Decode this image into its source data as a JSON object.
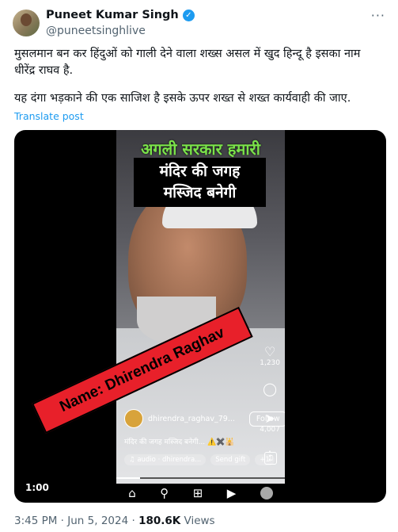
{
  "author": {
    "name": "Puneet Kumar Singh",
    "handle": "@puneetsinghlive",
    "more_icon": "more-icon"
  },
  "tweet": {
    "paragraph1": "मुसलमान बन कर हिंदुओं को गाली देने वाला शख्स असल में खुद हिन्दू है इसका नाम\nधीरेंद्र राघव है.",
    "paragraph2": "यह दंगा भड़काने की एक साजिश है इसके ऊपर शख्त से शख्त कार्यवाही की जाए.",
    "translate_label": "Translate post"
  },
  "video": {
    "overlay_green": "अगली सरकार हमारी",
    "overlay_box_line1": "मंदिर की जगह",
    "overlay_box_line2": "मस्जिद बनेगी",
    "banner": "Name: Dhirendra Raghav",
    "side_counts": [
      "1,230",
      "",
      "4,007",
      ""
    ],
    "reel_username": "dhirendra_raghav_79...",
    "follow_label": "Follow",
    "reel_caption": "मंदिर की जगह मस्जिद बनेगी... ⚠️✖️🕌",
    "music_label": "♫ audio · dhirendra...",
    "gift_label": "Send gift",
    "extra_label": "+1",
    "timecode": "1:00",
    "progress_fraction": 0.14
  },
  "meta": {
    "time": "3:45 PM · Jun 5, 2024 · ",
    "views_count": "180.6K",
    "views_label": " Views"
  }
}
